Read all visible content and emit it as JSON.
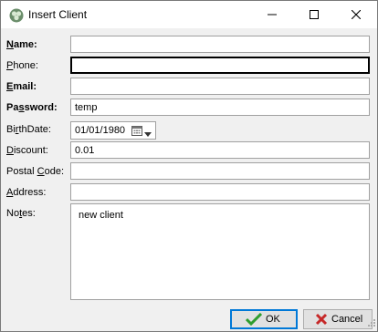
{
  "window": {
    "title": "Insert Client"
  },
  "form": {
    "name": {
      "label_pre": "",
      "label_mn": "N",
      "label_post": "ame:",
      "value": ""
    },
    "phone": {
      "label_pre": "",
      "label_mn": "P",
      "label_post": "hone:",
      "value": ""
    },
    "email": {
      "label_pre": "",
      "label_mn": "E",
      "label_post": "mail:",
      "value": ""
    },
    "password": {
      "label_pre": "Pa",
      "label_mn": "s",
      "label_post": "sword:",
      "value": "temp"
    },
    "birthdate": {
      "label_pre": "Bi",
      "label_mn": "r",
      "label_post": "thDate:",
      "value": "01/01/1980"
    },
    "discount": {
      "label_pre": "",
      "label_mn": "D",
      "label_post": "iscount:",
      "value": "0.01"
    },
    "postal_code": {
      "label_pre": "Postal ",
      "label_mn": "C",
      "label_post": "ode:",
      "value": ""
    },
    "address": {
      "label_pre": "",
      "label_mn": "A",
      "label_post": "ddress:",
      "value": ""
    },
    "notes": {
      "label_pre": "No",
      "label_mn": "t",
      "label_post": "es:",
      "value": "new client"
    }
  },
  "buttons": {
    "ok": "OK",
    "cancel": "Cancel"
  },
  "icons": {
    "app": "clover-app-icon",
    "calendar": "calendar-icon",
    "dropdown": "chevron-down-icon",
    "ok": "check-icon",
    "cancel": "x-icon"
  },
  "colors": {
    "ok_check": "#2e9d2e",
    "cancel_x": "#c62828",
    "focus_border": "#0078d7"
  }
}
